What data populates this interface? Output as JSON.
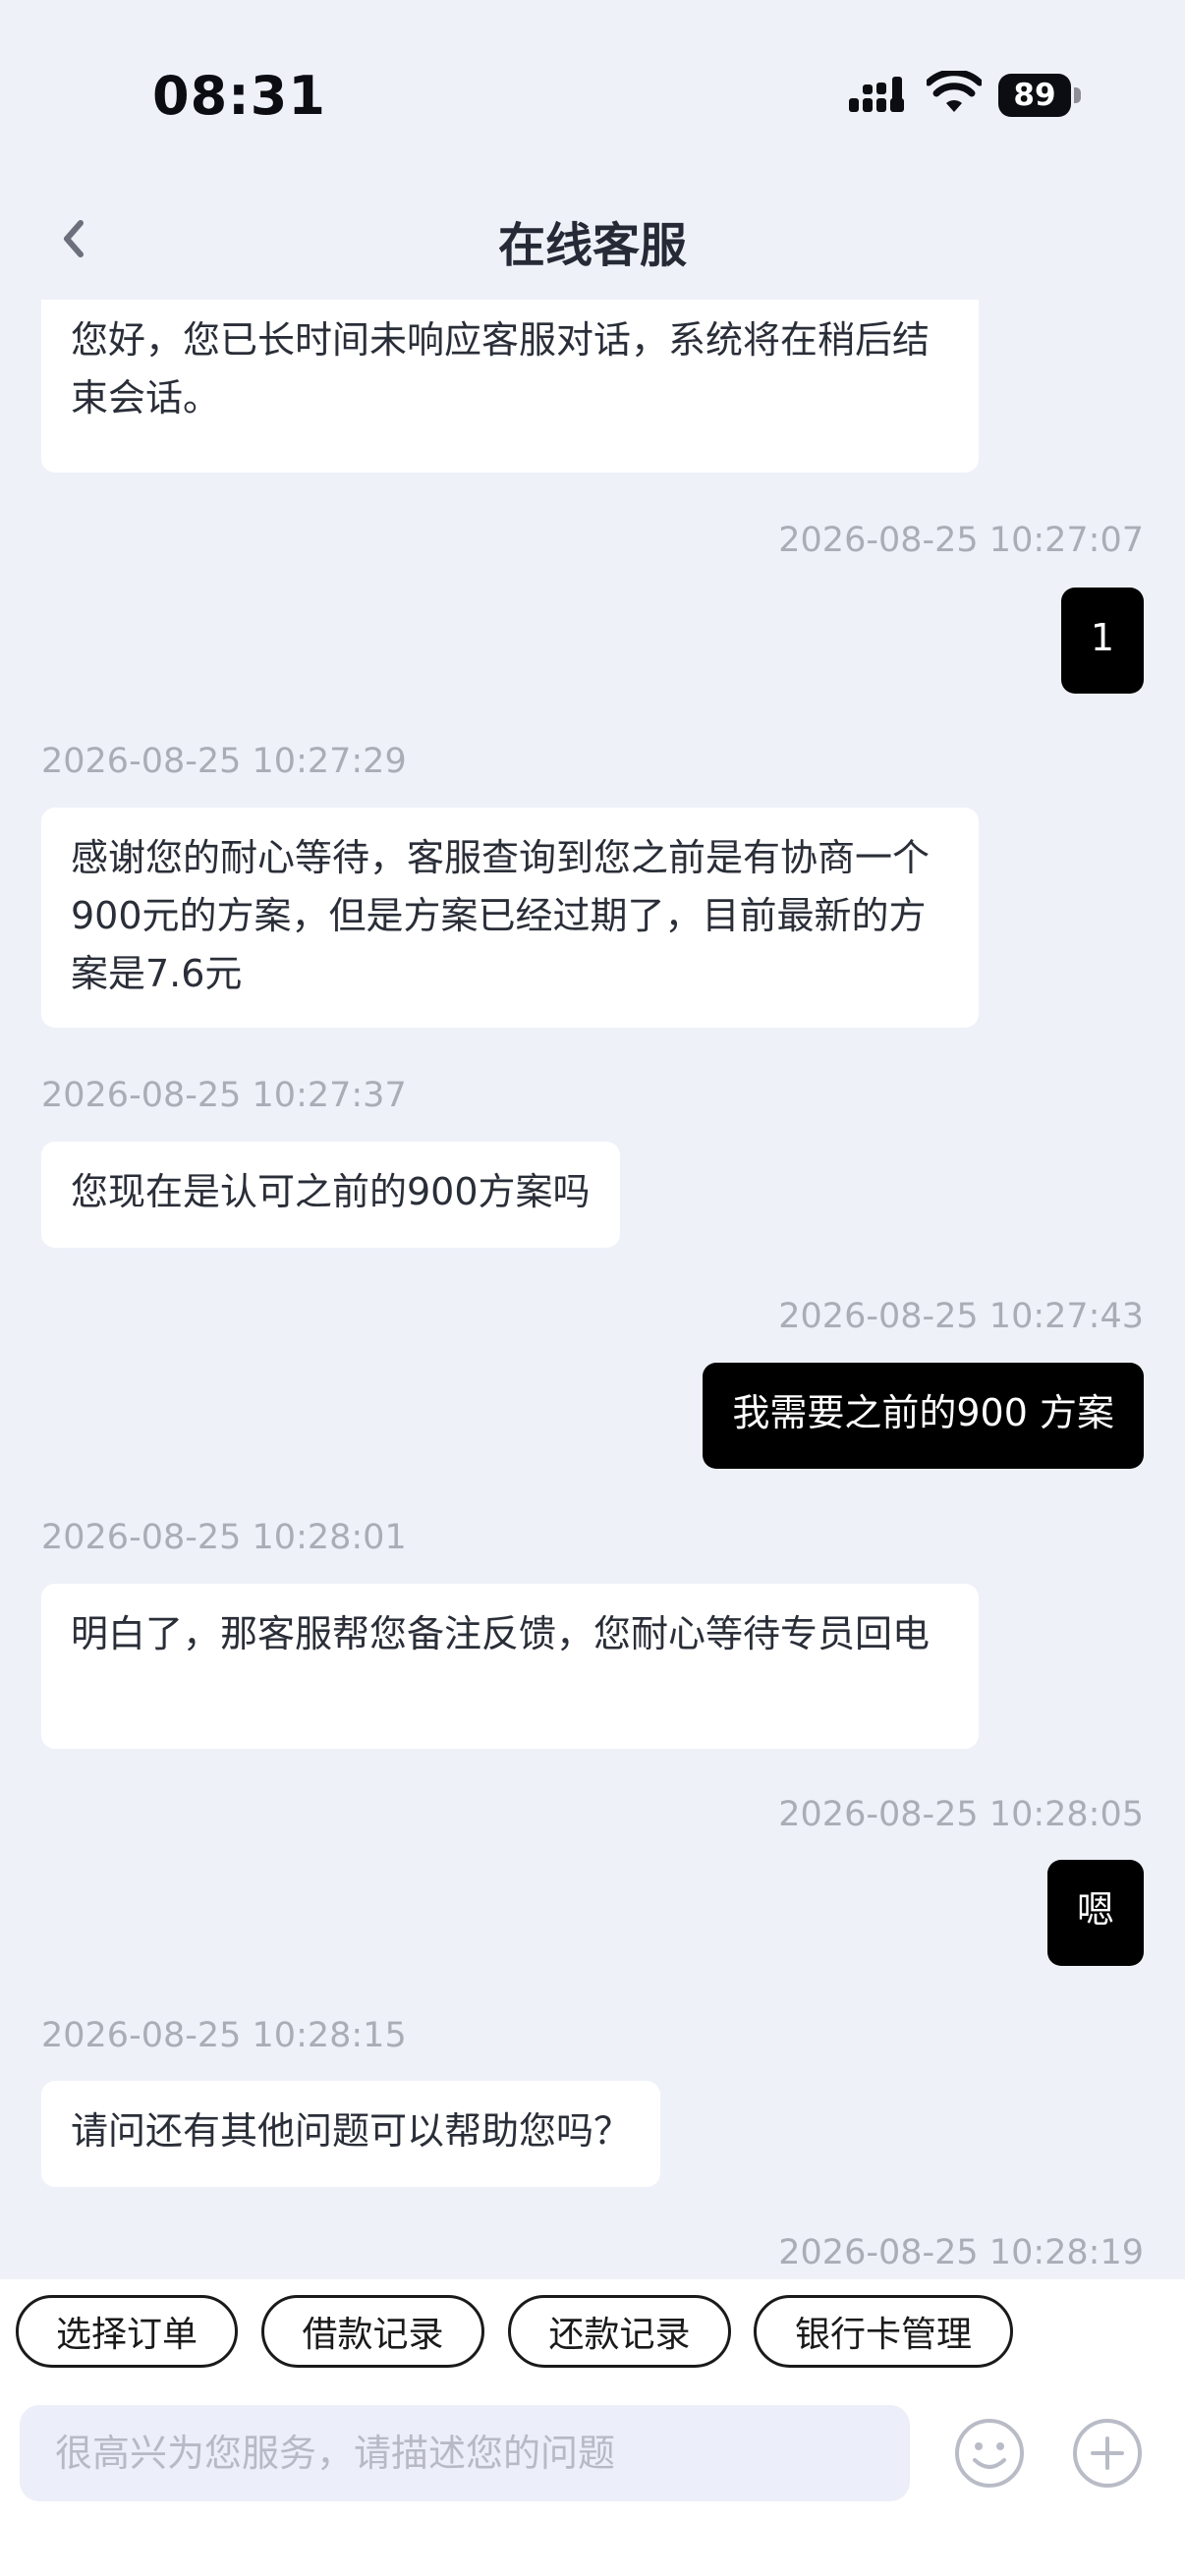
{
  "status_bar": {
    "time": "08:31",
    "battery_level": "89"
  },
  "header": {
    "title": "在线客服"
  },
  "messages": [
    {
      "sender": "agent",
      "text": "您好，您已长时间未响应客服对话，系统将在稍后结束会话。"
    },
    {
      "sender": "user",
      "time": "2026-08-25 10:27:07",
      "text": "1"
    },
    {
      "sender": "agent",
      "time": "2026-08-25 10:27:29",
      "text": "感谢您的耐心等待，客服查询到您之前是有协商一个900元的方案，但是方案已经过期了，目前最新的方案是7.6元"
    },
    {
      "sender": "agent",
      "time": "2026-08-25 10:27:37",
      "text": "您现在是认可之前的900方案吗"
    },
    {
      "sender": "user",
      "time": "2026-08-25 10:27:43",
      "text": "我需要之前的900 方案"
    },
    {
      "sender": "agent",
      "time": "2026-08-25 10:28:01",
      "text": "明白了，那客服帮您备注反馈，您耐心等待专员回电"
    },
    {
      "sender": "user",
      "time": "2026-08-25 10:28:05",
      "text": "嗯"
    },
    {
      "sender": "agent",
      "time": "2026-08-25 10:28:15",
      "text": "请问还有其他问题可以帮助您吗？"
    },
    {
      "sender": "user",
      "time": "2026-08-25 10:28:19",
      "text": ""
    }
  ],
  "quick_actions": [
    "选择订单",
    "借款记录",
    "还款记录",
    "银行卡管理"
  ],
  "input": {
    "placeholder": "很高兴为您服务，请描述您的问题",
    "value": ""
  },
  "icons": {
    "back": "chevron-left-icon",
    "emoji": "smiley-icon",
    "add": "plus-circle-icon",
    "signal": "cellular-signal-icon",
    "wifi": "wifi-icon",
    "battery": "battery-icon"
  }
}
